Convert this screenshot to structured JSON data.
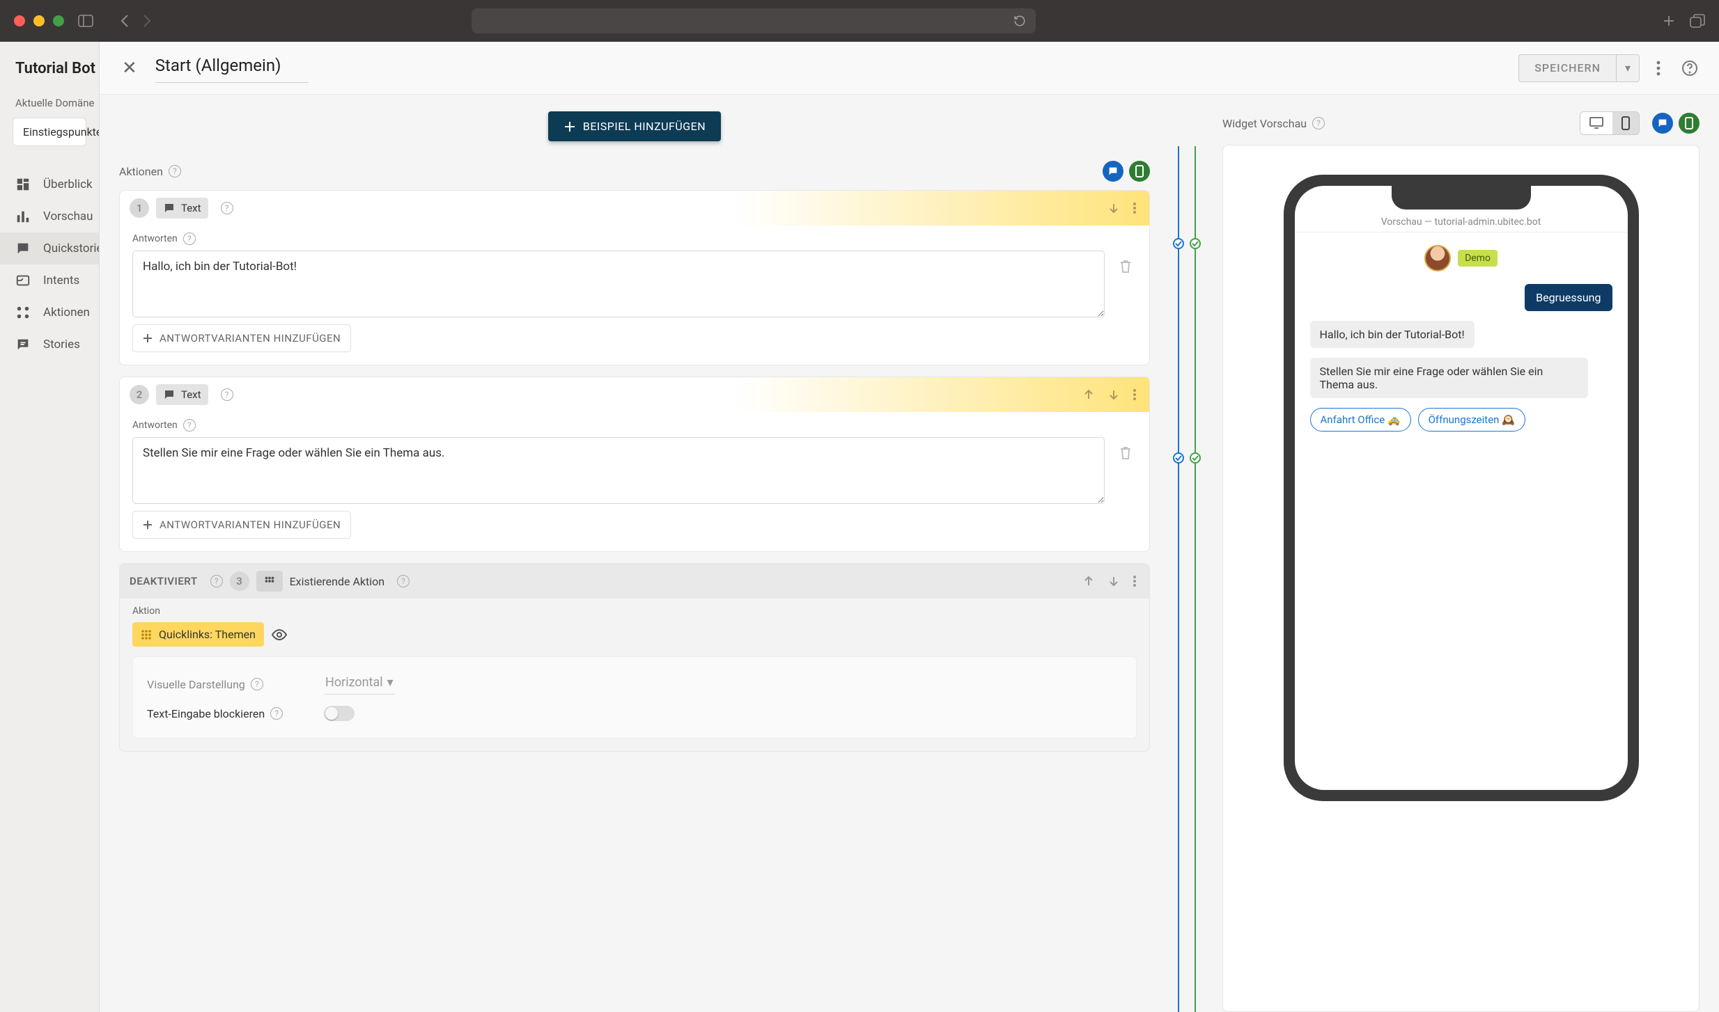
{
  "chrome": {},
  "sidebar": {
    "title": "Tutorial Bot",
    "domain_label": "Aktuelle Domäne",
    "entry_pill": "Einstiegspunkte",
    "items": [
      {
        "label": "Überblick"
      },
      {
        "label": "Vorschau"
      },
      {
        "label": "Quickstories"
      },
      {
        "label": "Intents"
      },
      {
        "label": "Aktionen"
      },
      {
        "label": "Stories"
      }
    ]
  },
  "header": {
    "title": "Start (Allgemein)",
    "save": "SPEICHERN"
  },
  "buttons": {
    "add_example": "BEISPIEL HINZUFÜGEN",
    "add_variant": "ANTWORTVARIANTEN HINZUFÜGEN"
  },
  "labels": {
    "aktionen": "Aktionen",
    "antworten": "Antworten",
    "widget_preview": "Widget Vorschau",
    "deaktiviert": "DEAKTIVIERT",
    "aktion": "Aktion",
    "visuelle": "Visuelle Darstellung",
    "text_block": "Text-Eingabe blockieren",
    "text_type": "Text",
    "existing_action": "Existierende Aktion",
    "horizontal": "Horizontal"
  },
  "actions": [
    {
      "num": "1",
      "answer": "Hallo, ich bin der Tutorial-Bot!"
    },
    {
      "num": "2",
      "answer": "Stellen Sie mir eine Frage oder wählen Sie ein Thema aus."
    }
  ],
  "quicklinks_chip": "Quicklinks: Themen",
  "phone": {
    "url_prefix": "Vorschau — ",
    "url_host": "tutorial-admin.ubitec.bot",
    "demo": "Demo",
    "user_msg": "Begruessung",
    "bot1": "Hallo, ich bin der Tutorial-Bot!",
    "bot2": "Stellen Sie mir eine Frage oder wählen Sie ein Thema aus.",
    "qr1": "Anfahrt Office 🚕",
    "qr2": "Öffnungszeiten 🕰️"
  },
  "disabled_num": "3"
}
